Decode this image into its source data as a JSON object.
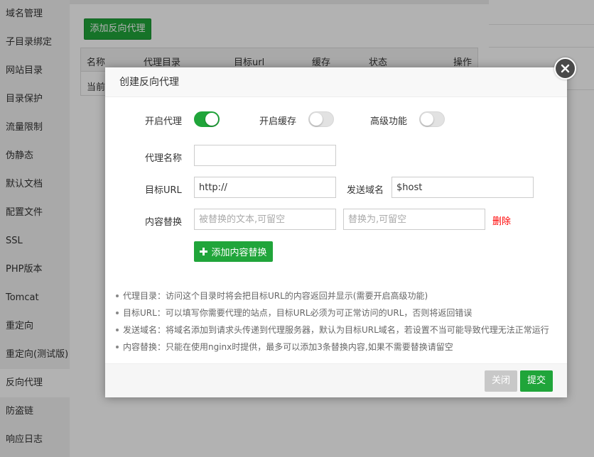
{
  "sidebar": {
    "items": [
      {
        "label": "域名管理"
      },
      {
        "label": "子目录绑定"
      },
      {
        "label": "网站目录"
      },
      {
        "label": "目录保护"
      },
      {
        "label": "流量限制"
      },
      {
        "label": "伪静态"
      },
      {
        "label": "默认文档"
      },
      {
        "label": "配置文件"
      },
      {
        "label": "SSL"
      },
      {
        "label": "PHP版本"
      },
      {
        "label": "Tomcat"
      },
      {
        "label": "重定向"
      },
      {
        "label": "重定向(测试版)"
      },
      {
        "label": "反向代理"
      },
      {
        "label": "防盗链"
      },
      {
        "label": "响应日志"
      }
    ],
    "active_index": 13
  },
  "main": {
    "add_button": "添加反向代理",
    "table": {
      "columns": [
        "名称",
        "代理目录",
        "目标url",
        "缓存",
        "状态",
        "操作"
      ],
      "empty_row": "当前"
    }
  },
  "modal": {
    "title": "创建反向代理",
    "switches": [
      {
        "label": "开启代理",
        "on": true
      },
      {
        "label": "开启缓存",
        "on": false
      },
      {
        "label": "高级功能",
        "on": false
      }
    ],
    "proxy_name": {
      "label": "代理名称",
      "value": "",
      "placeholder": ""
    },
    "target_url": {
      "label": "目标URL",
      "value": "http://"
    },
    "send_domain": {
      "label": "发送域名",
      "value": "$host"
    },
    "content_replace": {
      "label": "内容替换",
      "from_placeholder": "被替换的文本,可留空",
      "to_placeholder": "替换为,可留空",
      "delete_label": "删除"
    },
    "add_replace_button": "添加内容替换",
    "notes": [
      "代理目录：访问这个目录时将会把目标URL的内容返回并显示(需要开启高级功能)",
      "目标URL：可以填写你需要代理的站点，目标URL必须为可正常访问的URL，否则将返回错误",
      "发送域名：将域名添加到请求头传递到代理服务器，默认为目标URL域名，若设置不当可能导致代理无法正常运行",
      "内容替换：只能在使用nginx时提供，最多可以添加3条替换内容,如果不需要替换请留空"
    ],
    "footer": {
      "close_label": "关闭",
      "submit_label": "提交"
    }
  },
  "colors": {
    "accent": "#20a53a",
    "danger": "#ff0000",
    "disabled": "#c8c8c8"
  }
}
